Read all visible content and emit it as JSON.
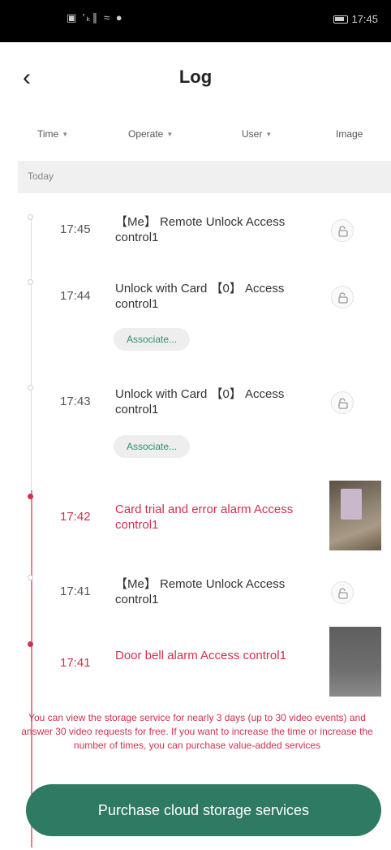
{
  "status_bar": {
    "left_icons": "▣ ′ₖ∥ ≈ ●",
    "time": "17:45"
  },
  "header": {
    "back_icon": "‹",
    "title": "Log"
  },
  "filters": [
    {
      "label": "Time",
      "has_caret": true
    },
    {
      "label": "Operate",
      "has_caret": true
    },
    {
      "label": "User",
      "has_caret": true
    },
    {
      "label": "Image",
      "has_caret": false
    }
  ],
  "section": {
    "label": "Today"
  },
  "logs": [
    {
      "time": "17:45",
      "text": "【Me】 Remote Unlock Access control1",
      "alarm": false,
      "action": "lock-icon"
    },
    {
      "time": "17:44",
      "text": "Unlock with Card 【0】 Access control1",
      "alarm": false,
      "action": "lock-icon",
      "associate": "Associate..."
    },
    {
      "time": "17:43",
      "text": "Unlock with Card 【0】 Access control1",
      "alarm": false,
      "action": "lock-icon",
      "associate": "Associate..."
    },
    {
      "time": "17:42",
      "text": "Card trial and error alarm Access control1",
      "alarm": true,
      "action": "thumbnail"
    },
    {
      "time": "17:41",
      "text": "【Me】 Remote Unlock Access control1",
      "alarm": false,
      "action": "lock-icon"
    },
    {
      "time": "17:41",
      "text": "Door bell alarm Access control1",
      "alarm": true,
      "action": "thumbnail"
    }
  ],
  "notice": "You can view the storage service for nearly 3 days (up to 30 video events) and answer 30 video requests for free. If you want to increase the time or increase the number of times, you can purchase value-added services",
  "purchase_button": "Purchase cloud storage services",
  "colors": {
    "accent": "#2e7a62",
    "alarm": "#d2304f",
    "associate_text": "#2e8f72"
  }
}
